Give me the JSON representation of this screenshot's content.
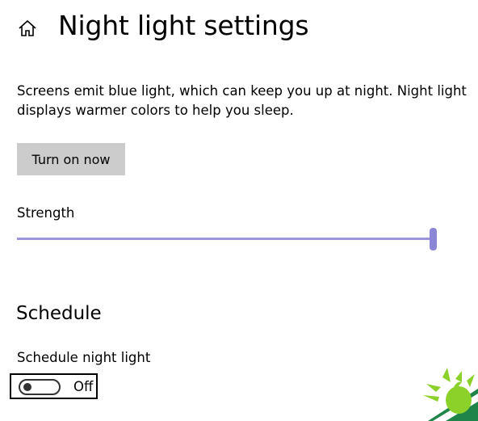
{
  "header": {
    "title": "Night light settings",
    "home_icon": "home-icon"
  },
  "description": "Screens emit blue light, which can keep you up at night. Night light displays warmer colors to help you sleep.",
  "turn_on_button": {
    "label": "Turn on now"
  },
  "strength": {
    "label": "Strength",
    "value_fraction": 1.0,
    "accent_color": "#8c86d6"
  },
  "schedule": {
    "heading": "Schedule",
    "toggle_label": "Schedule night light",
    "toggle_state": "Off"
  },
  "logo": {
    "icon": "watermark-logo-icon",
    "colors": [
      "#8cd02a",
      "#1e8449"
    ]
  }
}
